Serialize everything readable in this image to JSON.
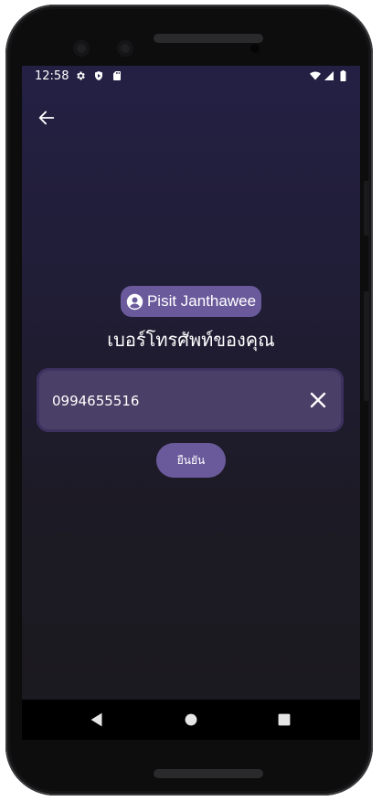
{
  "status_bar": {
    "time": "12:58",
    "left_icons": [
      "settings-icon",
      "shield-play-icon",
      "sd-card-icon"
    ],
    "right_icons": [
      "wifi-icon",
      "signal-icon",
      "battery-icon"
    ]
  },
  "header": {
    "back_icon": "arrow-left-icon"
  },
  "profile": {
    "name": "Pisit Janthawee",
    "icon": "account-circle-icon"
  },
  "form": {
    "title": "เบอร์โทรศัพท์ของคุณ",
    "phone_value": "0994655516",
    "clear_icon": "close-icon",
    "confirm_label": "ยืนยัน"
  },
  "nav_bar": {
    "buttons": [
      "back-triangle-icon",
      "home-circle-icon",
      "recents-square-icon"
    ]
  },
  "colors": {
    "accent": "#6a5a9c",
    "field_bg": "#4a3f66",
    "screen_top": "#232044",
    "screen_bottom": "#1b1a1f"
  }
}
